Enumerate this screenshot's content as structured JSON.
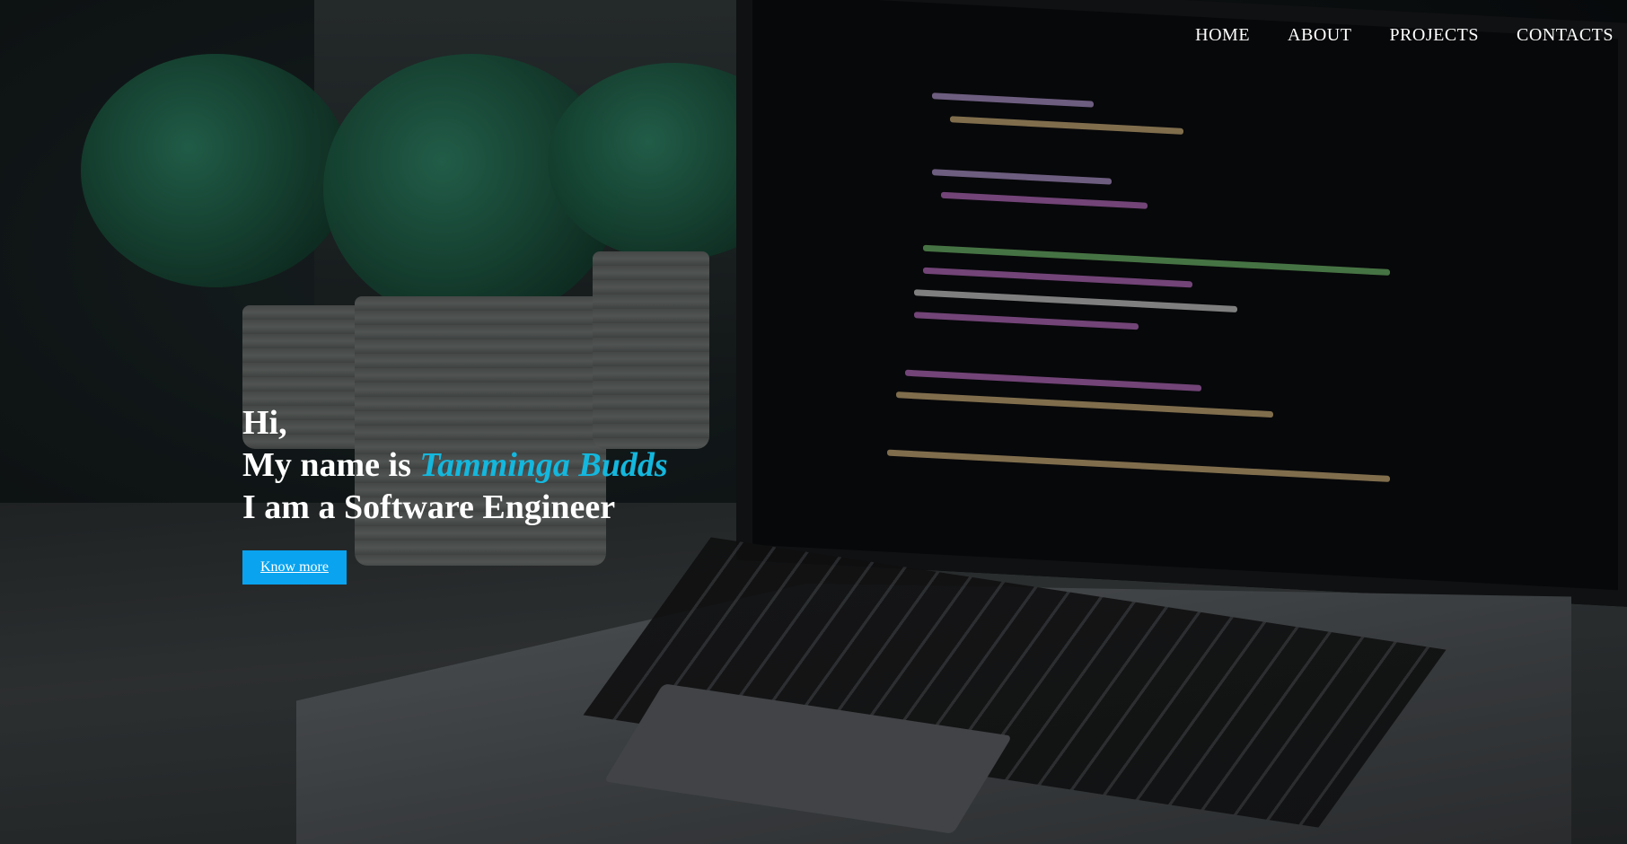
{
  "nav": {
    "items": [
      {
        "label": "HOME"
      },
      {
        "label": "ABOUT"
      },
      {
        "label": "PROJECTS"
      },
      {
        "label": "CONTACTS"
      }
    ]
  },
  "hero": {
    "greeting": "Hi,",
    "name_prefix": "My name is ",
    "name": "Tamminga Budds",
    "role": "I am a Software Engineer",
    "cta_label": "Know more"
  },
  "theme": {
    "accent": "#14b7dd",
    "button": "#0aa3ef"
  }
}
